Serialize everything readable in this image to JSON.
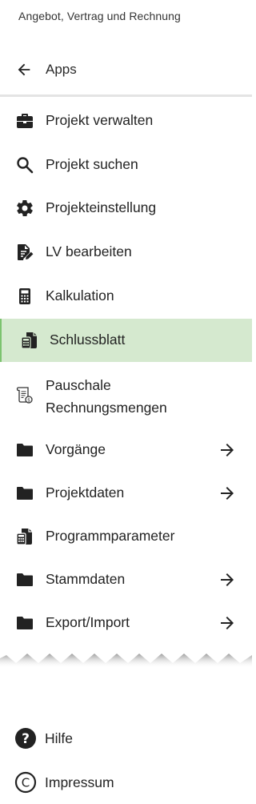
{
  "header": {
    "title": "Angebot, Vertrag und Rechnung"
  },
  "back": {
    "label": "Apps"
  },
  "menu": {
    "items": [
      {
        "label": "Projekt verwalten"
      },
      {
        "label": "Projekt suchen"
      },
      {
        "label": "Projekteinstellung"
      },
      {
        "label": "LV bearbeiten"
      },
      {
        "label": "Kalkulation"
      },
      {
        "label": "Schlussblatt"
      },
      {
        "label": "Pauschale Rechnungsmengen"
      },
      {
        "label": "Vorgänge"
      },
      {
        "label": "Projektdaten"
      },
      {
        "label": "Programmparameter"
      },
      {
        "label": "Stammdaten"
      },
      {
        "label": "Export/Import"
      }
    ]
  },
  "footer": {
    "items": [
      {
        "label": "Hilfe"
      },
      {
        "label": "Impressum"
      }
    ]
  },
  "colors": {
    "active_bg": "#d5e9cf",
    "active_border": "#7cc36f",
    "icon": "#222222"
  }
}
